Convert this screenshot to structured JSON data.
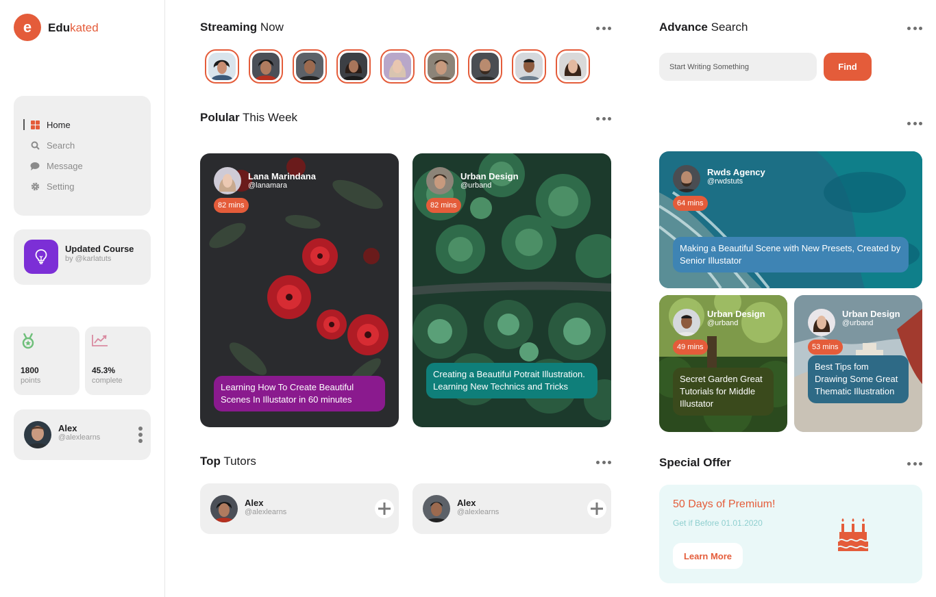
{
  "brand": {
    "initial": "e",
    "name_main": "Edu",
    "name_accent": "kated",
    "accent_color": "#e45c3a"
  },
  "nav": {
    "items": [
      {
        "label": "Home",
        "icon": "grid-icon",
        "active": true
      },
      {
        "label": "Search",
        "icon": "search-icon",
        "active": false
      },
      {
        "label": "Message",
        "icon": "chat-icon",
        "active": false
      },
      {
        "label": "Setting",
        "icon": "gear-icon",
        "active": false
      }
    ]
  },
  "course": {
    "title": "Updated Course",
    "by": "by @karlatuts",
    "icon": "lightbulb-icon",
    "icon_bg": "#7c2fd6"
  },
  "stats": [
    {
      "value": "1800",
      "label": "points",
      "icon": "medal-icon"
    },
    {
      "value": "45.3%",
      "label": "complete",
      "icon": "trend-up-icon"
    }
  ],
  "profile": {
    "name": "Alex",
    "handle": "@alexlearns"
  },
  "streaming": {
    "title_bold": "Streaming",
    "title_light": "Now",
    "count": 9
  },
  "popular": {
    "title_bold": "Polular",
    "title_light": "This Week",
    "cards": [
      {
        "name": "Lana Marindana",
        "handle": "@lanamara",
        "mins": "82 mins",
        "caption": "Learning How To Create Beautiful Scenes In Illustator in 60 minutes",
        "caption_color": "#8a1a8e"
      },
      {
        "name": "Urban Design",
        "handle": "@urband",
        "mins": "82 mins",
        "caption": "Creating a Beautiful Potrait Illustration. Learning New Technics and Tricks",
        "caption_color": "#0f7f7a"
      }
    ]
  },
  "tutors": {
    "title_bold": "Top",
    "title_light": "Tutors",
    "items": [
      {
        "name": "Alex",
        "handle": "@alexlearns"
      },
      {
        "name": "Alex",
        "handle": "@alexlearns"
      }
    ]
  },
  "search": {
    "title_bold": "Advance",
    "title_light": "Search",
    "placeholder": "Start Writing Something",
    "button": "Find"
  },
  "feature": {
    "main": {
      "name": "Rwds Agency",
      "handle": "@rwdstuts",
      "mins": "64 mins",
      "caption": "Making a Beautiful Scene with New Presets, Created by Senior Illustator",
      "caption_color": "#3e84b4"
    },
    "left": {
      "name": "Urban Design",
      "handle": "@urband",
      "mins": "49 mins",
      "caption": "Secret Garden Great Tutorials for Middle Illustator",
      "caption_color": "#3a4a1c"
    },
    "right": {
      "name": "Urban Design",
      "handle": "@urband",
      "mins": "53 mins",
      "caption": "Best Tips fom Drawing Some Great Thematic Illustration",
      "caption_color": "#2e6a86"
    }
  },
  "offer": {
    "title": "Special Offer",
    "headline": "50 Days of Premium!",
    "sub": "Get if Before 01.01.2020",
    "button": "Learn More",
    "icon": "cake-icon"
  }
}
